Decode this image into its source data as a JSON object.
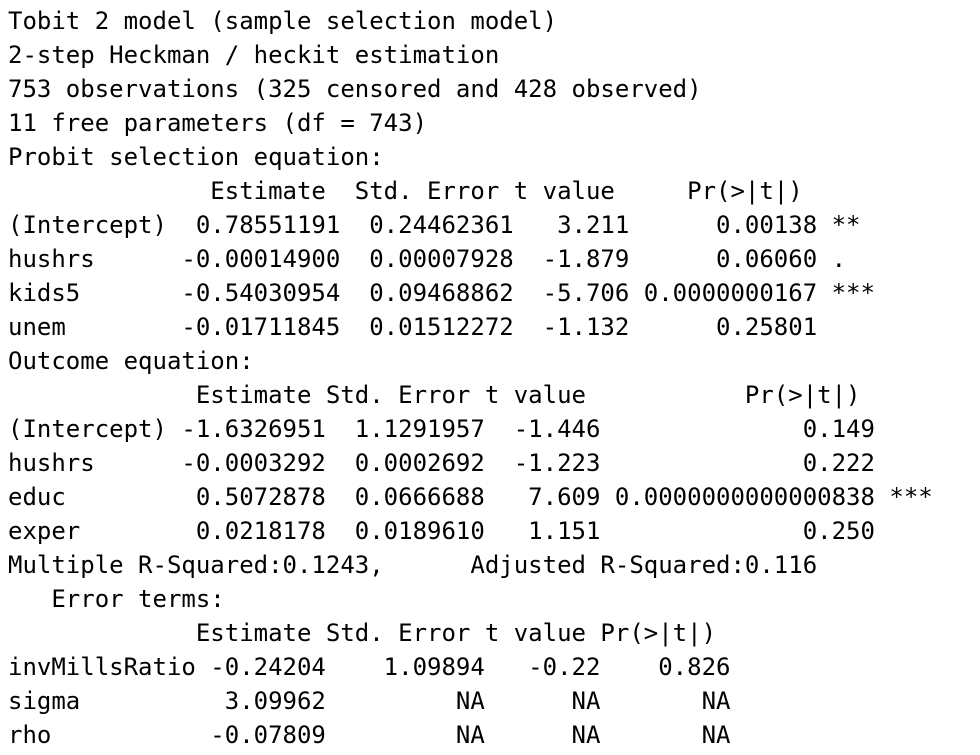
{
  "console": {
    "lines": [
      "Tobit 2 model (sample selection model)",
      "2-step Heckman / heckit estimation",
      "753 observations (325 censored and 428 observed)",
      "11 free parameters (df = 743)",
      "Probit selection equation:",
      "              Estimate  Std. Error t value     Pr(>|t|)",
      "(Intercept)  0.78551191  0.24462361   3.211      0.00138 **",
      "hushrs      -0.00014900  0.00007928  -1.879      0.06060 .",
      "kids5       -0.54030954  0.09468862  -5.706 0.0000000167 ***",
      "unem        -0.01711845  0.01512272  -1.132      0.25801",
      "Outcome equation:",
      "             Estimate Std. Error t value           Pr(>|t|)",
      "(Intercept) -1.6326951  1.1291957  -1.446              0.149",
      "hushrs      -0.0003292  0.0002692  -1.223              0.222",
      "educ         0.5072878  0.0666688   7.609 0.0000000000000838 ***",
      "exper        0.0218178  0.0189610   1.151              0.250",
      "Multiple R-Squared:0.1243,      Adjusted R-Squared:0.116",
      "   Error terms:",
      "             Estimate Std. Error t value Pr(>|t|)",
      "invMillsRatio -0.24204    1.09894   -0.22    0.826",
      "sigma          3.09962         NA      NA       NA",
      "rho           -0.07809         NA      NA       NA"
    ]
  }
}
